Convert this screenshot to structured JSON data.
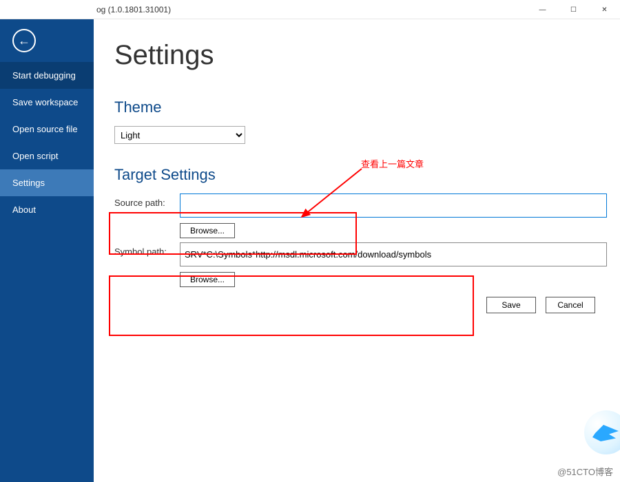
{
  "window": {
    "title_fragment": "og (1.0.1801.31001)"
  },
  "sidebar": {
    "items": [
      {
        "label": "Start debugging"
      },
      {
        "label": "Save workspace"
      },
      {
        "label": "Open source file"
      },
      {
        "label": "Open script"
      },
      {
        "label": "Settings"
      },
      {
        "label": "About"
      }
    ]
  },
  "page": {
    "title": "Settings",
    "theme_section": "Theme",
    "target_section": "Target Settings"
  },
  "theme": {
    "selected": "Light"
  },
  "target": {
    "source_label": "Source path:",
    "source_value": "",
    "symbol_label": "Symbol path:",
    "symbol_value": "SRV*C:\\Symbols*http://msdl.microsoft.com/download/symbols"
  },
  "buttons": {
    "browse": "Browse...",
    "save": "Save",
    "cancel": "Cancel"
  },
  "annotation": {
    "text": "查看上一篇文章"
  },
  "watermark": "@51CTO博客"
}
